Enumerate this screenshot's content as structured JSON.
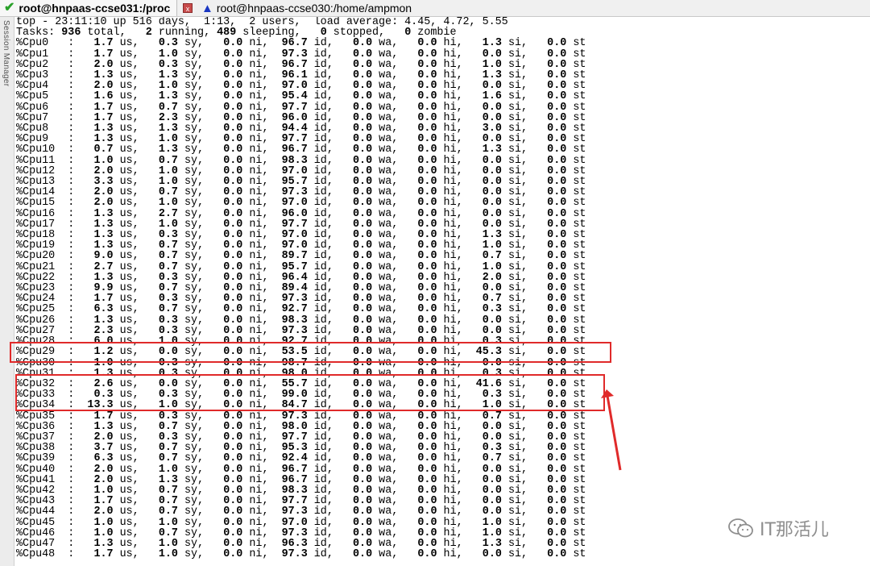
{
  "tabs": [
    {
      "title": "root@hnpaas-ccse031:/proc",
      "status_icon": "check-icon",
      "active": true
    },
    {
      "title": "root@hnpaas-ccse030:/home/ampmon",
      "status_icon": "warning-icon",
      "active": false
    }
  ],
  "sidebar": {
    "label": "Session Manager"
  },
  "terminal": {
    "header": {
      "line1": "top - 23:11:10 up 516 days,  1:13,  2 users,  load average: 4.45, 4.72, 5.55",
      "tasks_label": "Tasks:",
      "tasks_total": "936",
      "tasks_running": "2",
      "tasks_sleeping": "489",
      "tasks_stopped": "0",
      "tasks_zombie": "0"
    },
    "columns": [
      "us",
      "sy",
      "ni",
      "id",
      "wa",
      "hi",
      "si",
      "st"
    ],
    "cpu_rows": [
      {
        "cpu": "%Cpu0",
        "us": "1.7",
        "sy": "0.3",
        "ni": "0.0",
        "id": "96.7",
        "wa": "0.0",
        "hi": "0.0",
        "si": "1.3",
        "st": "0.0"
      },
      {
        "cpu": "%Cpu1",
        "us": "1.7",
        "sy": "1.0",
        "ni": "0.0",
        "id": "97.3",
        "wa": "0.0",
        "hi": "0.0",
        "si": "0.0",
        "st": "0.0"
      },
      {
        "cpu": "%Cpu2",
        "us": "2.0",
        "sy": "0.3",
        "ni": "0.0",
        "id": "96.7",
        "wa": "0.0",
        "hi": "0.0",
        "si": "1.0",
        "st": "0.0"
      },
      {
        "cpu": "%Cpu3",
        "us": "1.3",
        "sy": "1.3",
        "ni": "0.0",
        "id": "96.1",
        "wa": "0.0",
        "hi": "0.0",
        "si": "1.3",
        "st": "0.0"
      },
      {
        "cpu": "%Cpu4",
        "us": "2.0",
        "sy": "1.0",
        "ni": "0.0",
        "id": "97.0",
        "wa": "0.0",
        "hi": "0.0",
        "si": "0.0",
        "st": "0.0"
      },
      {
        "cpu": "%Cpu5",
        "us": "1.6",
        "sy": "1.3",
        "ni": "0.0",
        "id": "95.4",
        "wa": "0.0",
        "hi": "0.0",
        "si": "1.6",
        "st": "0.0"
      },
      {
        "cpu": "%Cpu6",
        "us": "1.7",
        "sy": "0.7",
        "ni": "0.0",
        "id": "97.7",
        "wa": "0.0",
        "hi": "0.0",
        "si": "0.0",
        "st": "0.0"
      },
      {
        "cpu": "%Cpu7",
        "us": "1.7",
        "sy": "2.3",
        "ni": "0.0",
        "id": "96.0",
        "wa": "0.0",
        "hi": "0.0",
        "si": "0.0",
        "st": "0.0"
      },
      {
        "cpu": "%Cpu8",
        "us": "1.3",
        "sy": "1.3",
        "ni": "0.0",
        "id": "94.4",
        "wa": "0.0",
        "hi": "0.0",
        "si": "3.0",
        "st": "0.0"
      },
      {
        "cpu": "%Cpu9",
        "us": "1.3",
        "sy": "1.0",
        "ni": "0.0",
        "id": "97.7",
        "wa": "0.0",
        "hi": "0.0",
        "si": "0.0",
        "st": "0.0"
      },
      {
        "cpu": "%Cpu10",
        "us": "0.7",
        "sy": "1.3",
        "ni": "0.0",
        "id": "96.7",
        "wa": "0.0",
        "hi": "0.0",
        "si": "1.3",
        "st": "0.0"
      },
      {
        "cpu": "%Cpu11",
        "us": "1.0",
        "sy": "0.7",
        "ni": "0.0",
        "id": "98.3",
        "wa": "0.0",
        "hi": "0.0",
        "si": "0.0",
        "st": "0.0"
      },
      {
        "cpu": "%Cpu12",
        "us": "2.0",
        "sy": "1.0",
        "ni": "0.0",
        "id": "97.0",
        "wa": "0.0",
        "hi": "0.0",
        "si": "0.0",
        "st": "0.0"
      },
      {
        "cpu": "%Cpu13",
        "us": "3.3",
        "sy": "1.0",
        "ni": "0.0",
        "id": "95.7",
        "wa": "0.0",
        "hi": "0.0",
        "si": "0.0",
        "st": "0.0"
      },
      {
        "cpu": "%Cpu14",
        "us": "2.0",
        "sy": "0.7",
        "ni": "0.0",
        "id": "97.3",
        "wa": "0.0",
        "hi": "0.0",
        "si": "0.0",
        "st": "0.0"
      },
      {
        "cpu": "%Cpu15",
        "us": "2.0",
        "sy": "1.0",
        "ni": "0.0",
        "id": "97.0",
        "wa": "0.0",
        "hi": "0.0",
        "si": "0.0",
        "st": "0.0"
      },
      {
        "cpu": "%Cpu16",
        "us": "1.3",
        "sy": "2.7",
        "ni": "0.0",
        "id": "96.0",
        "wa": "0.0",
        "hi": "0.0",
        "si": "0.0",
        "st": "0.0"
      },
      {
        "cpu": "%Cpu17",
        "us": "1.3",
        "sy": "1.0",
        "ni": "0.0",
        "id": "97.7",
        "wa": "0.0",
        "hi": "0.0",
        "si": "0.0",
        "st": "0.0"
      },
      {
        "cpu": "%Cpu18",
        "us": "1.3",
        "sy": "0.3",
        "ni": "0.0",
        "id": "97.0",
        "wa": "0.0",
        "hi": "0.0",
        "si": "1.3",
        "st": "0.0"
      },
      {
        "cpu": "%Cpu19",
        "us": "1.3",
        "sy": "0.7",
        "ni": "0.0",
        "id": "97.0",
        "wa": "0.0",
        "hi": "0.0",
        "si": "1.0",
        "st": "0.0"
      },
      {
        "cpu": "%Cpu20",
        "us": "9.0",
        "sy": "0.7",
        "ni": "0.0",
        "id": "89.7",
        "wa": "0.0",
        "hi": "0.0",
        "si": "0.7",
        "st": "0.0"
      },
      {
        "cpu": "%Cpu21",
        "us": "2.7",
        "sy": "0.7",
        "ni": "0.0",
        "id": "95.7",
        "wa": "0.0",
        "hi": "0.0",
        "si": "1.0",
        "st": "0.0"
      },
      {
        "cpu": "%Cpu22",
        "us": "1.3",
        "sy": "0.3",
        "ni": "0.0",
        "id": "96.4",
        "wa": "0.0",
        "hi": "0.0",
        "si": "2.0",
        "st": "0.0"
      },
      {
        "cpu": "%Cpu23",
        "us": "9.9",
        "sy": "0.7",
        "ni": "0.0",
        "id": "89.4",
        "wa": "0.0",
        "hi": "0.0",
        "si": "0.0",
        "st": "0.0"
      },
      {
        "cpu": "%Cpu24",
        "us": "1.7",
        "sy": "0.3",
        "ni": "0.0",
        "id": "97.3",
        "wa": "0.0",
        "hi": "0.0",
        "si": "0.7",
        "st": "0.0"
      },
      {
        "cpu": "%Cpu25",
        "us": "6.3",
        "sy": "0.7",
        "ni": "0.0",
        "id": "92.7",
        "wa": "0.0",
        "hi": "0.0",
        "si": "0.3",
        "st": "0.0"
      },
      {
        "cpu": "%Cpu26",
        "us": "1.3",
        "sy": "0.3",
        "ni": "0.0",
        "id": "98.3",
        "wa": "0.0",
        "hi": "0.0",
        "si": "0.0",
        "st": "0.0"
      },
      {
        "cpu": "%Cpu27",
        "us": "2.3",
        "sy": "0.3",
        "ni": "0.0",
        "id": "97.3",
        "wa": "0.0",
        "hi": "0.0",
        "si": "0.0",
        "st": "0.0"
      },
      {
        "cpu": "%Cpu28",
        "us": "6.0",
        "sy": "1.0",
        "ni": "0.0",
        "id": "92.7",
        "wa": "0.0",
        "hi": "0.0",
        "si": "0.3",
        "st": "0.0"
      },
      {
        "cpu": "%Cpu29",
        "us": "1.2",
        "sy": "0.0",
        "ni": "0.0",
        "id": "53.5",
        "wa": "0.0",
        "hi": "0.0",
        "si": "45.3",
        "st": "0.0"
      },
      {
        "cpu": "%Cpu30",
        "us": "1.0",
        "sy": "0.3",
        "ni": "0.0",
        "id": "98.7",
        "wa": "0.0",
        "hi": "0.0",
        "si": "0.0",
        "st": "0.0"
      },
      {
        "cpu": "%Cpu31",
        "us": "1.3",
        "sy": "0.3",
        "ni": "0.0",
        "id": "98.0",
        "wa": "0.0",
        "hi": "0.0",
        "si": "0.3",
        "st": "0.0"
      },
      {
        "cpu": "%Cpu32",
        "us": "2.6",
        "sy": "0.0",
        "ni": "0.0",
        "id": "55.7",
        "wa": "0.0",
        "hi": "0.0",
        "si": "41.6",
        "st": "0.0"
      },
      {
        "cpu": "%Cpu33",
        "us": "0.3",
        "sy": "0.3",
        "ni": "0.0",
        "id": "99.0",
        "wa": "0.0",
        "hi": "0.0",
        "si": "0.3",
        "st": "0.0"
      },
      {
        "cpu": "%Cpu34",
        "us": "13.3",
        "sy": "1.0",
        "ni": "0.0",
        "id": "84.7",
        "wa": "0.0",
        "hi": "0.0",
        "si": "1.0",
        "st": "0.0"
      },
      {
        "cpu": "%Cpu35",
        "us": "1.7",
        "sy": "0.3",
        "ni": "0.0",
        "id": "97.3",
        "wa": "0.0",
        "hi": "0.0",
        "si": "0.7",
        "st": "0.0"
      },
      {
        "cpu": "%Cpu36",
        "us": "1.3",
        "sy": "0.7",
        "ni": "0.0",
        "id": "98.0",
        "wa": "0.0",
        "hi": "0.0",
        "si": "0.0",
        "st": "0.0"
      },
      {
        "cpu": "%Cpu37",
        "us": "2.0",
        "sy": "0.3",
        "ni": "0.0",
        "id": "97.7",
        "wa": "0.0",
        "hi": "0.0",
        "si": "0.0",
        "st": "0.0"
      },
      {
        "cpu": "%Cpu38",
        "us": "3.7",
        "sy": "0.7",
        "ni": "0.0",
        "id": "95.3",
        "wa": "0.0",
        "hi": "0.0",
        "si": "0.3",
        "st": "0.0"
      },
      {
        "cpu": "%Cpu39",
        "us": "6.3",
        "sy": "0.7",
        "ni": "0.0",
        "id": "92.4",
        "wa": "0.0",
        "hi": "0.0",
        "si": "0.7",
        "st": "0.0"
      },
      {
        "cpu": "%Cpu40",
        "us": "2.0",
        "sy": "1.0",
        "ni": "0.0",
        "id": "96.7",
        "wa": "0.0",
        "hi": "0.0",
        "si": "0.0",
        "st": "0.0"
      },
      {
        "cpu": "%Cpu41",
        "us": "2.0",
        "sy": "1.3",
        "ni": "0.0",
        "id": "96.7",
        "wa": "0.0",
        "hi": "0.0",
        "si": "0.0",
        "st": "0.0"
      },
      {
        "cpu": "%Cpu42",
        "us": "1.0",
        "sy": "0.7",
        "ni": "0.0",
        "id": "98.3",
        "wa": "0.0",
        "hi": "0.0",
        "si": "0.0",
        "st": "0.0"
      },
      {
        "cpu": "%Cpu43",
        "us": "1.7",
        "sy": "0.7",
        "ni": "0.0",
        "id": "97.7",
        "wa": "0.0",
        "hi": "0.0",
        "si": "0.0",
        "st": "0.0"
      },
      {
        "cpu": "%Cpu44",
        "us": "2.0",
        "sy": "0.7",
        "ni": "0.0",
        "id": "97.3",
        "wa": "0.0",
        "hi": "0.0",
        "si": "0.0",
        "st": "0.0"
      },
      {
        "cpu": "%Cpu45",
        "us": "1.0",
        "sy": "1.0",
        "ni": "0.0",
        "id": "97.0",
        "wa": "0.0",
        "hi": "0.0",
        "si": "1.0",
        "st": "0.0"
      },
      {
        "cpu": "%Cpu46",
        "us": "1.0",
        "sy": "0.7",
        "ni": "0.0",
        "id": "97.3",
        "wa": "0.0",
        "hi": "0.0",
        "si": "1.0",
        "st": "0.0"
      },
      {
        "cpu": "%Cpu47",
        "us": "1.3",
        "sy": "1.0",
        "ni": "0.0",
        "id": "96.3",
        "wa": "0.0",
        "hi": "0.0",
        "si": "1.3",
        "st": "0.0"
      },
      {
        "cpu": "%Cpu48",
        "us": "1.7",
        "sy": "1.0",
        "ni": "0.0",
        "id": "97.3",
        "wa": "0.0",
        "hi": "0.0",
        "si": "0.0",
        "st": "0.0"
      }
    ]
  },
  "annotations": {
    "highlight_color": "#e02a2a",
    "highlighted_cpus": [
      "%Cpu29",
      "%Cpu32",
      "%Cpu33"
    ]
  },
  "watermark": {
    "text": "IT那活儿",
    "icon": "wechat-icon"
  }
}
